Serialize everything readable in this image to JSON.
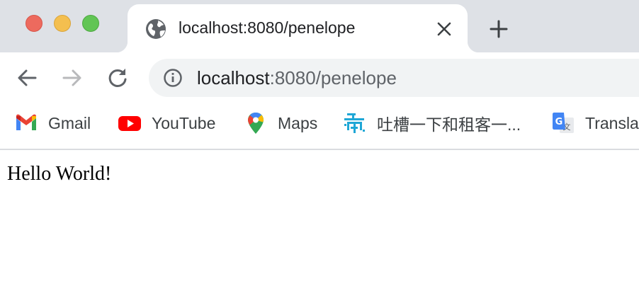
{
  "window": {
    "controls": [
      "close",
      "minimize",
      "zoom"
    ]
  },
  "tab": {
    "title": "localhost:8080/penelope",
    "favicon": "globe-icon"
  },
  "toolbar": {
    "url_host": "localhost",
    "url_rest": ":8080/penelope"
  },
  "bookmarks": [
    {
      "label": "Gmail",
      "icon": "gmail-icon"
    },
    {
      "label": "YouTube",
      "icon": "youtube-icon"
    },
    {
      "label": "Maps",
      "icon": "maps-icon"
    },
    {
      "label": "吐槽一下和租客一...",
      "icon": "tucao-icon"
    },
    {
      "label": "Transla",
      "icon": "translate-icon"
    }
  ],
  "page": {
    "text": "Hello World!"
  },
  "colors": {
    "tabstrip": "#dee1e6",
    "omnibox": "#f1f3f4",
    "close": "#ed6a5e",
    "minimize": "#f4bf4f",
    "zoom": "#61c554"
  }
}
